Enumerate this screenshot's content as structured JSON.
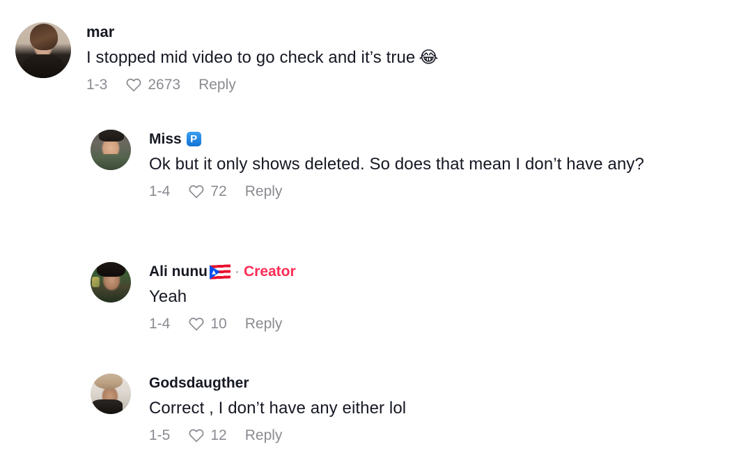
{
  "thread": {
    "comments": [
      {
        "id": "comment-mar",
        "username": "mar",
        "avatar_name": "avatar-mar",
        "username_emoji": "",
        "is_creator": false,
        "text": "I stopped mid video to go check and it’s true",
        "trailing_emoji": "😂",
        "date": "1-3",
        "likes": "2673",
        "reply_label": "Reply",
        "depth": "root"
      },
      {
        "id": "comment-miss",
        "username": "Miss",
        "avatar_name": "avatar-miss",
        "username_emoji": "🅿️",
        "emoji_name": "p-button-emoji",
        "is_creator": false,
        "text": "Ok but it only shows deleted. So does that mean I don’t have any?",
        "trailing_emoji": "",
        "date": "1-4",
        "likes": "72",
        "reply_label": "Reply",
        "depth": "reply"
      },
      {
        "id": "comment-ali",
        "username": "Ali nunu",
        "avatar_name": "avatar-ali",
        "username_emoji": "🇵🇷",
        "emoji_name": "puerto-rico-flag-emoji",
        "is_creator": true,
        "creator_separator": "·",
        "creator_label": "Creator",
        "text": "Yeah",
        "trailing_emoji": "",
        "date": "1-4",
        "likes": "10",
        "reply_label": "Reply",
        "depth": "reply"
      },
      {
        "id": "comment-godsdaugther",
        "username": "Godsdaugther",
        "avatar_name": "avatar-godsdaugther",
        "username_emoji": "",
        "is_creator": false,
        "text": "Correct , I don’t have any either lol",
        "trailing_emoji": "",
        "date": "1-5",
        "likes": "12",
        "reply_label": "Reply",
        "depth": "reply"
      }
    ]
  },
  "colors": {
    "background": "#ffffff",
    "text_primary": "#161823",
    "text_muted": "#8a8b91",
    "creator_accent": "#fe2c55",
    "p_badge_blue": "#1273d4"
  }
}
